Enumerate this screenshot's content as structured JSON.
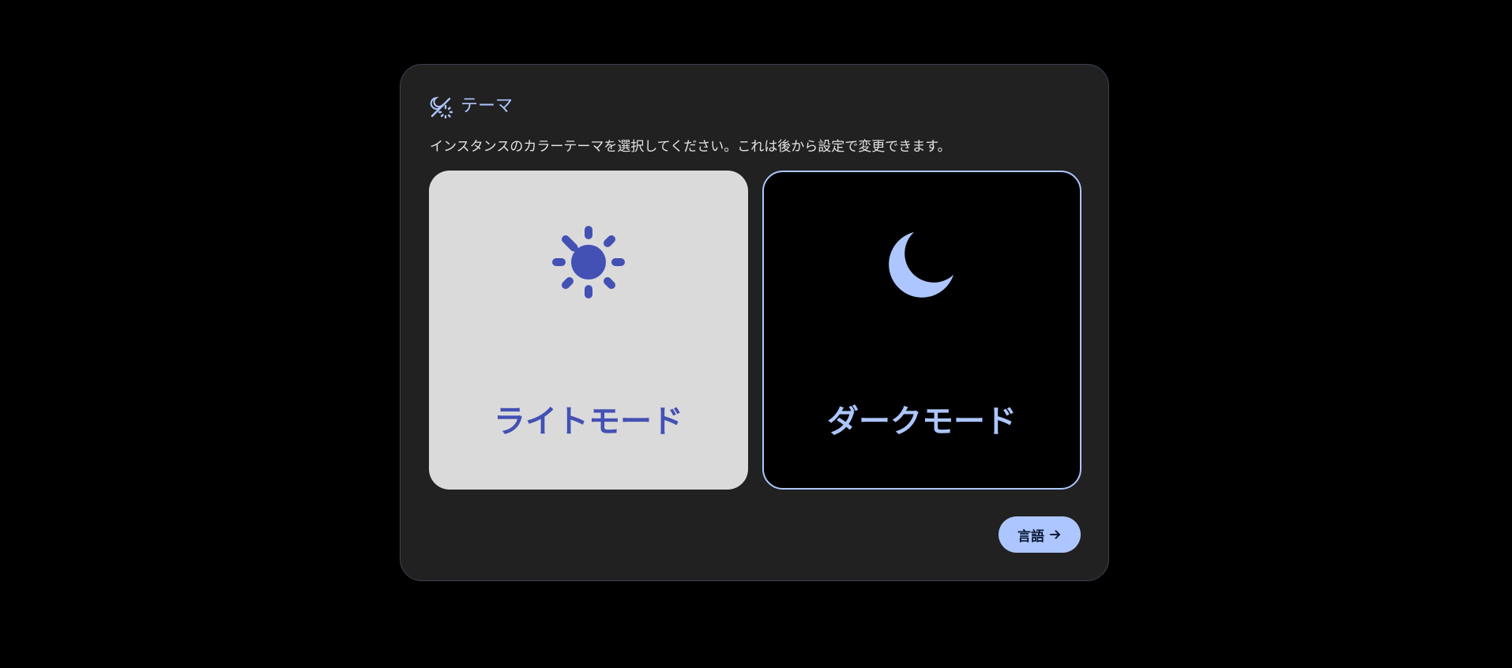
{
  "dialog": {
    "title": "テーマ",
    "title_icon": "theme-icon",
    "description": "インスタンスのカラーテーマを選択してください。これは後から設定で変更できます。"
  },
  "options": [
    {
      "label": "ライトモード",
      "icon": "sun-icon",
      "selected": false
    },
    {
      "label": "ダークモード",
      "icon": "moon-icon",
      "selected": true
    }
  ],
  "next_button": {
    "label": "言語",
    "icon": "arrow-right-icon"
  },
  "colors": {
    "accent": "#adc6ff",
    "light_accent": "#4350b4",
    "surface": "#212121",
    "light_card": "#dadada",
    "dark_card": "#000000"
  }
}
